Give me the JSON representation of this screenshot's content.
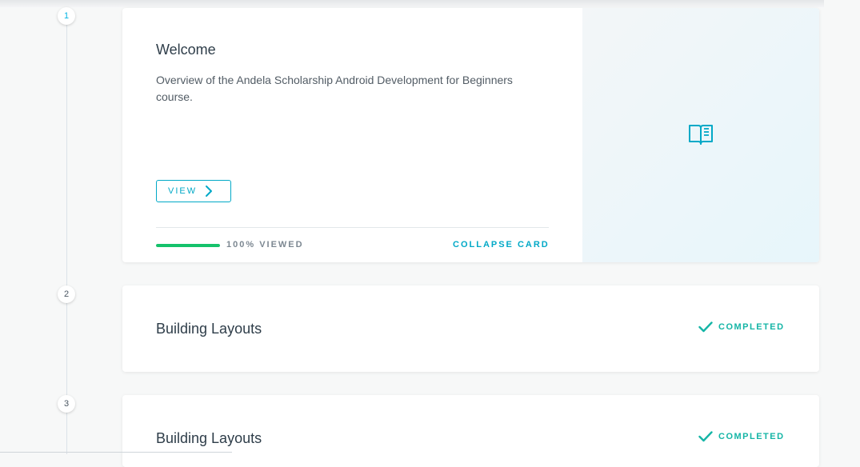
{
  "steps": [
    "1",
    "2",
    "3"
  ],
  "welcome": {
    "title": "Welcome",
    "description": "Overview of the Andela Scholarship Android Development for Beginners course.",
    "view_label": "VIEW",
    "progress_percent": 100,
    "progress_text": "100% VIEWED",
    "collapse_label": "COLLAPSE CARD",
    "icon": "book-icon"
  },
  "lessons": [
    {
      "title": "Building Layouts",
      "status": "COMPLETED",
      "icon": "check-icon"
    },
    {
      "title": "Building Layouts",
      "status": "COMPLETED",
      "icon": "check-icon"
    }
  ],
  "colors": {
    "accent": "#02a9c7",
    "progress": "#15c26b",
    "completed": "#15b5a6"
  }
}
